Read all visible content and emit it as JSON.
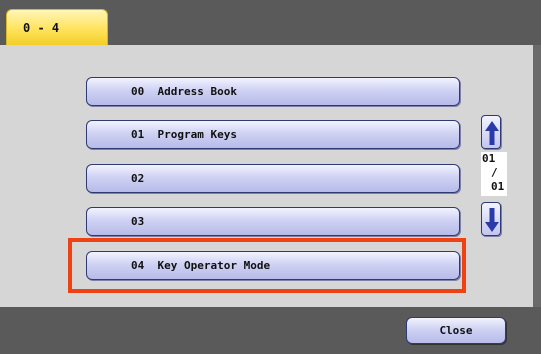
{
  "tab": {
    "label": "0 - 4"
  },
  "list": {
    "items": [
      {
        "label": "00  Address Book"
      },
      {
        "label": "01  Program Keys"
      },
      {
        "label": "02"
      },
      {
        "label": "03"
      },
      {
        "label": "04  Key Operator Mode"
      }
    ],
    "highlighted_item": "04  Key Operator Mode",
    "highlight_color": "#ee4213"
  },
  "pagination": {
    "current": "01",
    "separator": "/",
    "total": "01",
    "up_icon": "arrow-up-icon",
    "down_icon": "arrow-down-icon"
  },
  "footer": {
    "close_label": "Close"
  },
  "colors": {
    "bar": "#5a5a5a",
    "panel": "#d6d6d6",
    "tab": "#ffe35c",
    "button": "#cfd2f3",
    "arrow": "#2a3aa8"
  }
}
